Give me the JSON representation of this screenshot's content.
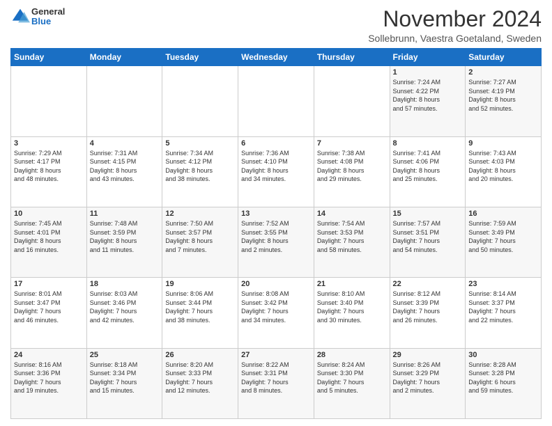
{
  "logo": {
    "general": "General",
    "blue": "Blue"
  },
  "header": {
    "month": "November 2024",
    "location": "Sollebrunn, Vaestra Goetaland, Sweden"
  },
  "weekdays": [
    "Sunday",
    "Monday",
    "Tuesday",
    "Wednesday",
    "Thursday",
    "Friday",
    "Saturday"
  ],
  "weeks": [
    [
      {
        "day": "",
        "info": ""
      },
      {
        "day": "",
        "info": ""
      },
      {
        "day": "",
        "info": ""
      },
      {
        "day": "",
        "info": ""
      },
      {
        "day": "",
        "info": ""
      },
      {
        "day": "1",
        "info": "Sunrise: 7:24 AM\nSunset: 4:22 PM\nDaylight: 8 hours\nand 57 minutes."
      },
      {
        "day": "2",
        "info": "Sunrise: 7:27 AM\nSunset: 4:19 PM\nDaylight: 8 hours\nand 52 minutes."
      }
    ],
    [
      {
        "day": "3",
        "info": "Sunrise: 7:29 AM\nSunset: 4:17 PM\nDaylight: 8 hours\nand 48 minutes."
      },
      {
        "day": "4",
        "info": "Sunrise: 7:31 AM\nSunset: 4:15 PM\nDaylight: 8 hours\nand 43 minutes."
      },
      {
        "day": "5",
        "info": "Sunrise: 7:34 AM\nSunset: 4:12 PM\nDaylight: 8 hours\nand 38 minutes."
      },
      {
        "day": "6",
        "info": "Sunrise: 7:36 AM\nSunset: 4:10 PM\nDaylight: 8 hours\nand 34 minutes."
      },
      {
        "day": "7",
        "info": "Sunrise: 7:38 AM\nSunset: 4:08 PM\nDaylight: 8 hours\nand 29 minutes."
      },
      {
        "day": "8",
        "info": "Sunrise: 7:41 AM\nSunset: 4:06 PM\nDaylight: 8 hours\nand 25 minutes."
      },
      {
        "day": "9",
        "info": "Sunrise: 7:43 AM\nSunset: 4:03 PM\nDaylight: 8 hours\nand 20 minutes."
      }
    ],
    [
      {
        "day": "10",
        "info": "Sunrise: 7:45 AM\nSunset: 4:01 PM\nDaylight: 8 hours\nand 16 minutes."
      },
      {
        "day": "11",
        "info": "Sunrise: 7:48 AM\nSunset: 3:59 PM\nDaylight: 8 hours\nand 11 minutes."
      },
      {
        "day": "12",
        "info": "Sunrise: 7:50 AM\nSunset: 3:57 PM\nDaylight: 8 hours\nand 7 minutes."
      },
      {
        "day": "13",
        "info": "Sunrise: 7:52 AM\nSunset: 3:55 PM\nDaylight: 8 hours\nand 2 minutes."
      },
      {
        "day": "14",
        "info": "Sunrise: 7:54 AM\nSunset: 3:53 PM\nDaylight: 7 hours\nand 58 minutes."
      },
      {
        "day": "15",
        "info": "Sunrise: 7:57 AM\nSunset: 3:51 PM\nDaylight: 7 hours\nand 54 minutes."
      },
      {
        "day": "16",
        "info": "Sunrise: 7:59 AM\nSunset: 3:49 PM\nDaylight: 7 hours\nand 50 minutes."
      }
    ],
    [
      {
        "day": "17",
        "info": "Sunrise: 8:01 AM\nSunset: 3:47 PM\nDaylight: 7 hours\nand 46 minutes."
      },
      {
        "day": "18",
        "info": "Sunrise: 8:03 AM\nSunset: 3:46 PM\nDaylight: 7 hours\nand 42 minutes."
      },
      {
        "day": "19",
        "info": "Sunrise: 8:06 AM\nSunset: 3:44 PM\nDaylight: 7 hours\nand 38 minutes."
      },
      {
        "day": "20",
        "info": "Sunrise: 8:08 AM\nSunset: 3:42 PM\nDaylight: 7 hours\nand 34 minutes."
      },
      {
        "day": "21",
        "info": "Sunrise: 8:10 AM\nSunset: 3:40 PM\nDaylight: 7 hours\nand 30 minutes."
      },
      {
        "day": "22",
        "info": "Sunrise: 8:12 AM\nSunset: 3:39 PM\nDaylight: 7 hours\nand 26 minutes."
      },
      {
        "day": "23",
        "info": "Sunrise: 8:14 AM\nSunset: 3:37 PM\nDaylight: 7 hours\nand 22 minutes."
      }
    ],
    [
      {
        "day": "24",
        "info": "Sunrise: 8:16 AM\nSunset: 3:36 PM\nDaylight: 7 hours\nand 19 minutes."
      },
      {
        "day": "25",
        "info": "Sunrise: 8:18 AM\nSunset: 3:34 PM\nDaylight: 7 hours\nand 15 minutes."
      },
      {
        "day": "26",
        "info": "Sunrise: 8:20 AM\nSunset: 3:33 PM\nDaylight: 7 hours\nand 12 minutes."
      },
      {
        "day": "27",
        "info": "Sunrise: 8:22 AM\nSunset: 3:31 PM\nDaylight: 7 hours\nand 8 minutes."
      },
      {
        "day": "28",
        "info": "Sunrise: 8:24 AM\nSunset: 3:30 PM\nDaylight: 7 hours\nand 5 minutes."
      },
      {
        "day": "29",
        "info": "Sunrise: 8:26 AM\nSunset: 3:29 PM\nDaylight: 7 hours\nand 2 minutes."
      },
      {
        "day": "30",
        "info": "Sunrise: 8:28 AM\nSunset: 3:28 PM\nDaylight: 6 hours\nand 59 minutes."
      }
    ]
  ]
}
